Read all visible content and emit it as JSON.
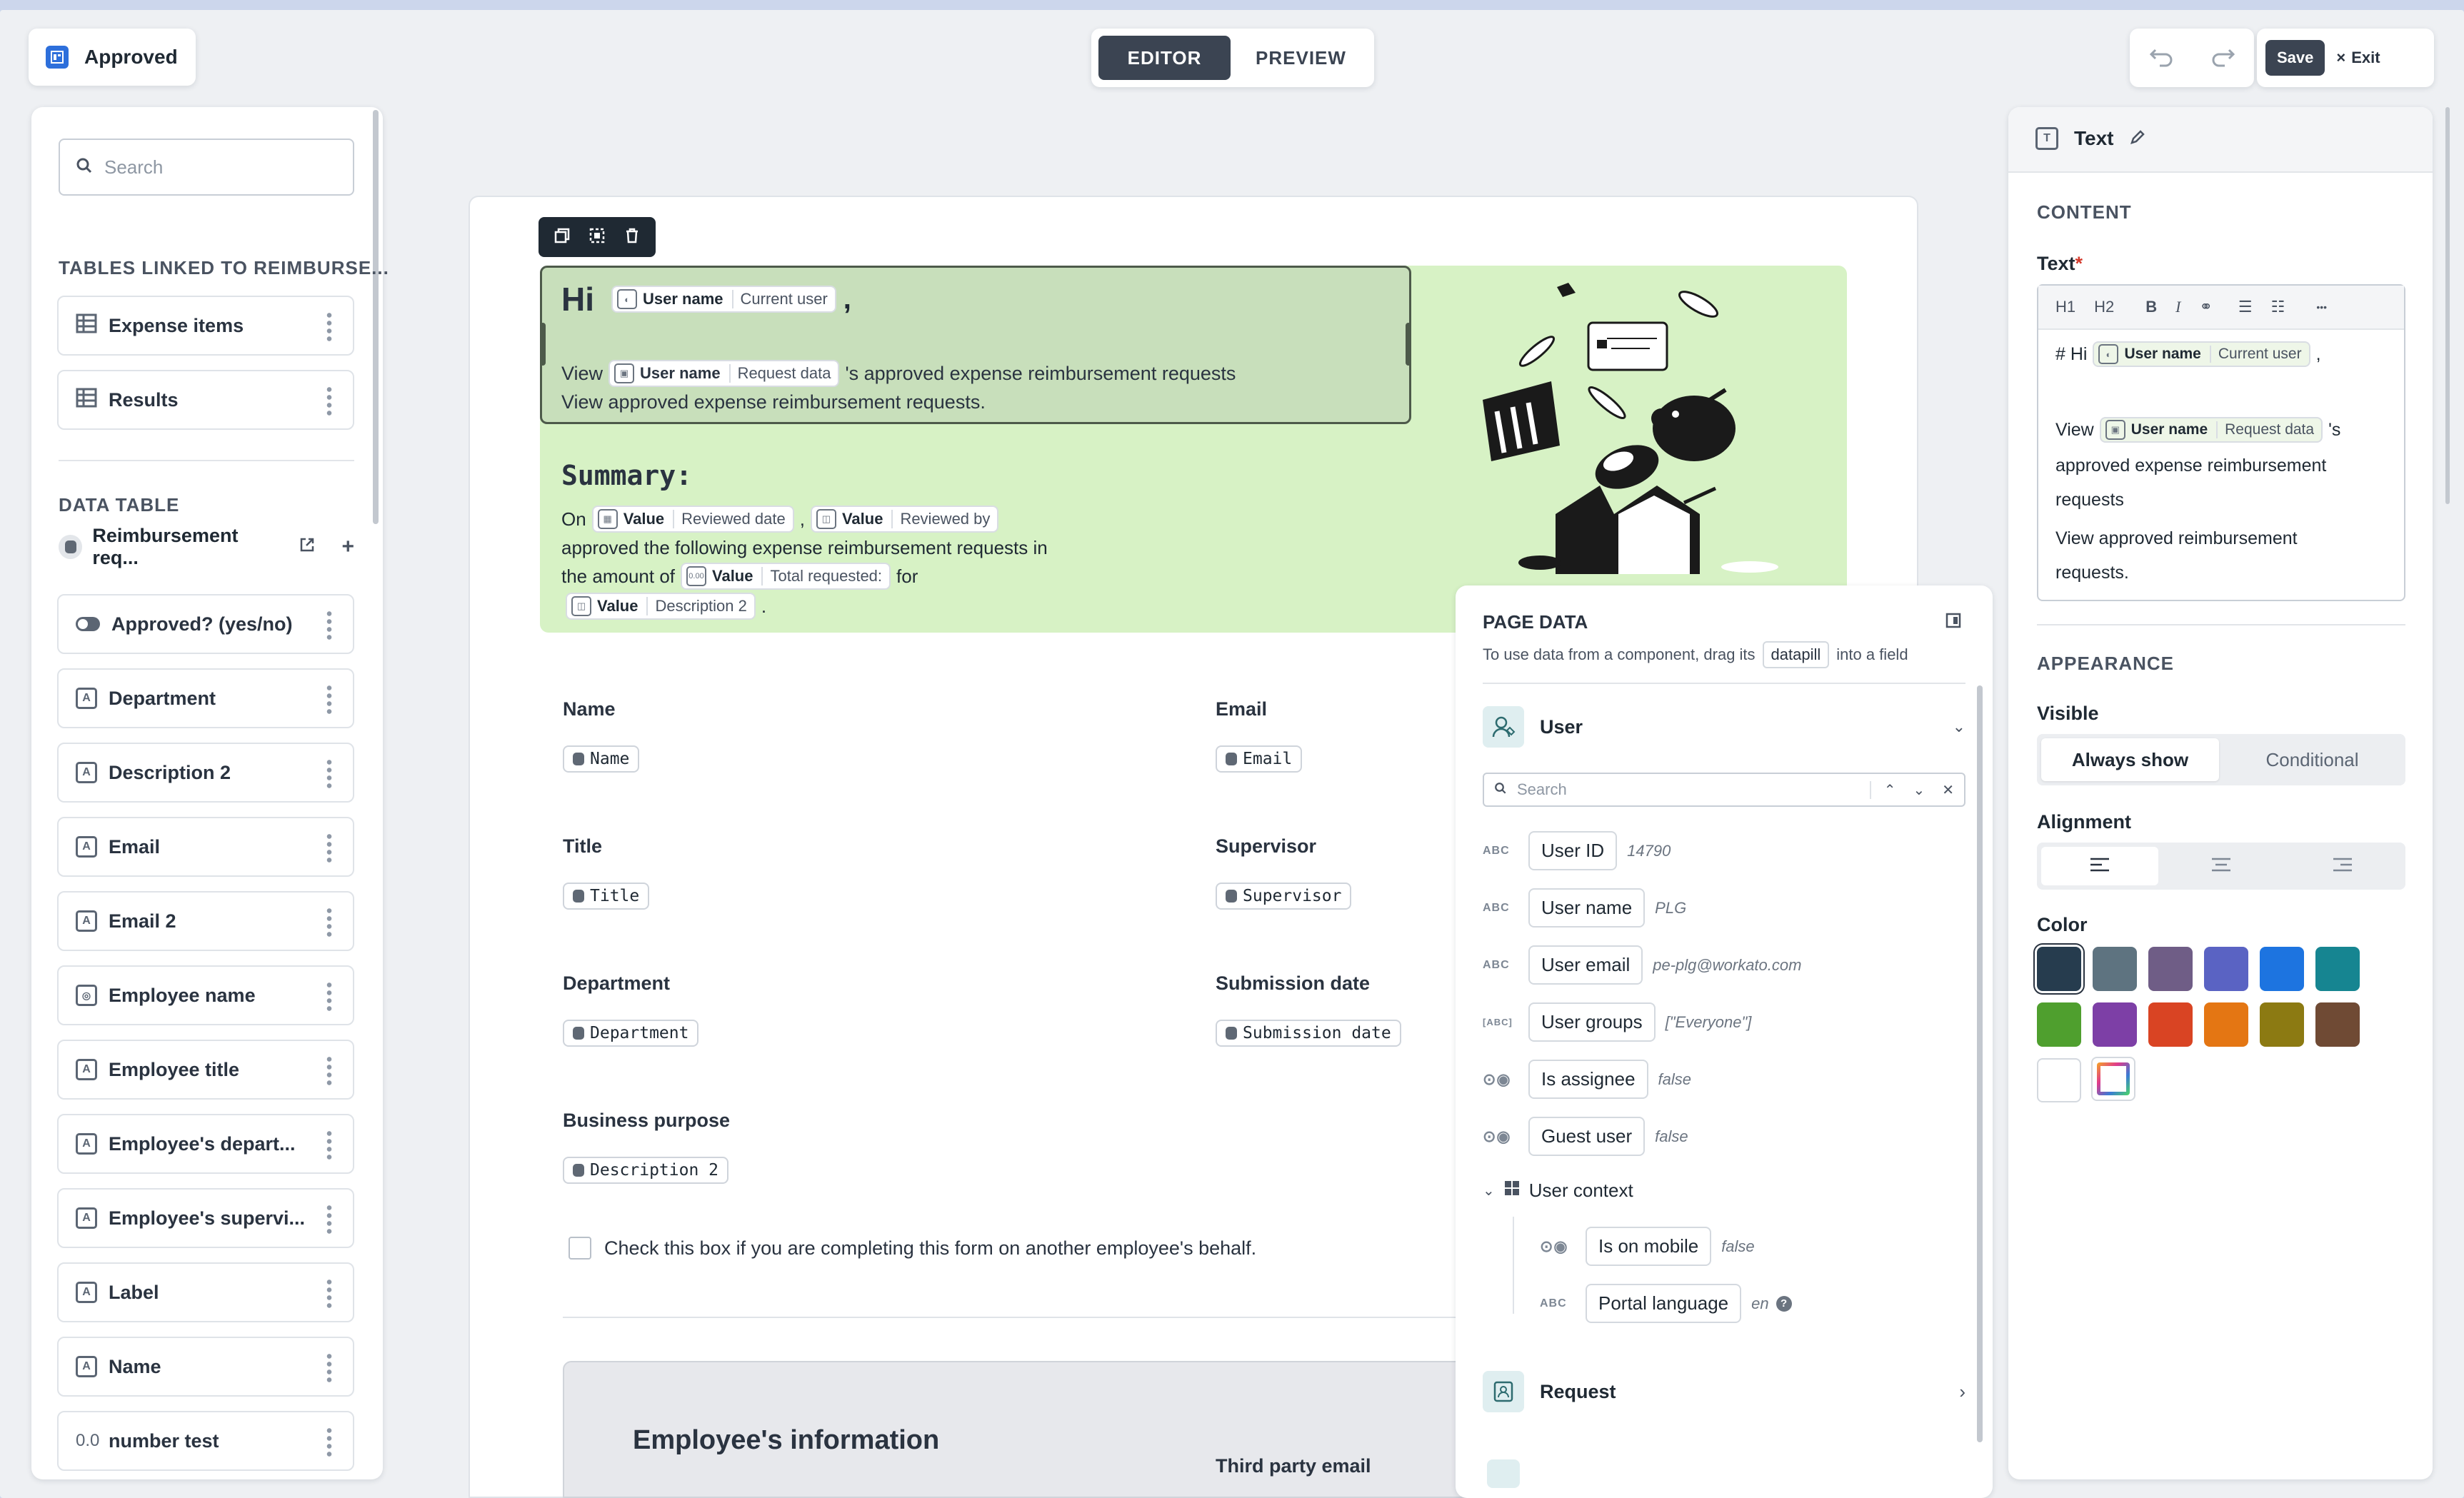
{
  "top_bar": {
    "app_name": "Approved",
    "mode_tabs": [
      "EDITOR",
      "PREVIEW"
    ],
    "save_label": "Save",
    "exit_label": "Exit"
  },
  "sidebar": {
    "search_placeholder": "Search",
    "tables_heading": "TABLES LINKED TO REIMBURSE...",
    "tables": [
      {
        "label": "Expense items",
        "icon": "table-icon"
      },
      {
        "label": "Results",
        "icon": "table-icon"
      }
    ],
    "data_table_heading": "DATA TABLE",
    "data_table_name": "Reimbursement req...",
    "fields": [
      {
        "label": "Approved? (yes/no)",
        "icon": "toggle-icon"
      },
      {
        "label": "Department",
        "icon": "text-field-icon"
      },
      {
        "label": "Description 2",
        "icon": "text-field-icon"
      },
      {
        "label": "Email",
        "icon": "text-field-icon"
      },
      {
        "label": "Email 2",
        "icon": "text-field-icon"
      },
      {
        "label": "Employee name",
        "icon": "user-field-icon"
      },
      {
        "label": "Employee title",
        "icon": "text-field-icon"
      },
      {
        "label": "Employee's depart...",
        "icon": "text-field-icon"
      },
      {
        "label": "Employee's supervi...",
        "icon": "text-field-icon"
      },
      {
        "label": "Label",
        "icon": "text-field-icon"
      },
      {
        "label": "Name",
        "icon": "text-field-icon"
      },
      {
        "label": "number test",
        "icon": "number-field-icon",
        "glyph": "0.0"
      }
    ]
  },
  "page": {
    "greeting": "Hi",
    "comma": ",",
    "pill_user_name": "User name",
    "pill_current_user": "Current user",
    "pill_request_data": "Request data",
    "view_word": "View",
    "view_suffix": "'s approved expense reimbursement requests",
    "view_line2": "View approved expense reimbursement requests.",
    "summary_heading": "Summary:",
    "summary_on": "On",
    "pill_value": "Value",
    "pill_reviewed_date": "Reviewed date",
    "pill_reviewed_by": "Reviewed by",
    "summary_line2": "approved the following expense reimbursement requests in",
    "summary_amount": "the amount of",
    "pill_total_requested": "Total requested:",
    "summary_for": "for",
    "pill_description2": "Description 2",
    "period": ".",
    "form_fields": [
      {
        "label": "Name",
        "value": "Name"
      },
      {
        "label": "Email",
        "value": "Email"
      },
      {
        "label": "Title",
        "value": "Title"
      },
      {
        "label": "Supervisor",
        "value": "Supervisor"
      },
      {
        "label": "Department",
        "value": "Department"
      },
      {
        "label": "Submission date",
        "value": "Submission date"
      },
      {
        "label": "Business purpose",
        "value": "Description 2"
      }
    ],
    "checkbox_label": "Check this box if you are completing this form on another employee's behalf.",
    "employee_info_heading": "Employee's information",
    "third_party_email": "Third party email"
  },
  "page_data_panel": {
    "title": "PAGE DATA",
    "hint_prefix": "To use data from a component, drag its",
    "hint_pill": "datapill",
    "hint_suffix": "into a field",
    "user_section": "User",
    "search_placeholder": "Search",
    "rows": [
      {
        "type": "ABC",
        "name": "User ID",
        "value": "14790"
      },
      {
        "type": "ABC",
        "name": "User name",
        "value": "PLG"
      },
      {
        "type": "ABC",
        "name": "User email",
        "value": "pe-plg@workato.com"
      },
      {
        "type": "[ABC]",
        "name": "User groups",
        "value": "[\"Everyone\"]"
      },
      {
        "type": "toggle",
        "name": "Is assignee",
        "value": "false"
      },
      {
        "type": "toggle",
        "name": "Guest user",
        "value": "false"
      }
    ],
    "user_context_label": "User context",
    "context_rows": [
      {
        "type": "toggle",
        "name": "Is on mobile",
        "value": "false"
      },
      {
        "type": "ABC",
        "name": "Portal language",
        "value": "en"
      }
    ],
    "request_section": "Request"
  },
  "properties": {
    "component_title": "Text",
    "content_heading": "CONTENT",
    "text_label": "Text",
    "required_mark": "*",
    "editor_h1": "H1",
    "editor_h2": "H2",
    "editor_bold": "B",
    "editor_italic": "I",
    "editor_more": "•••",
    "editor_prefix": "# Hi",
    "editor_view": "View",
    "editor_view_suffix": "'s",
    "editor_line2": "approved expense reimbursement",
    "editor_line3": "requests",
    "editor_line4": "View approved reimbursement",
    "editor_line5": "requests.",
    "appearance_heading": "APPEARANCE",
    "visible_label": "Visible",
    "visible_options": [
      "Always show",
      "Conditional"
    ],
    "alignment_label": "Alignment",
    "color_label": "Color",
    "colors": [
      "#263c4e",
      "#5e7380",
      "#6f5d86",
      "#5a63c3",
      "#1d74e0",
      "#168591",
      "#4f9f2e",
      "#7d3fa6",
      "#d94423",
      "#e47613",
      "#8c7a12",
      "#6f4a34",
      "#ffffff"
    ]
  }
}
